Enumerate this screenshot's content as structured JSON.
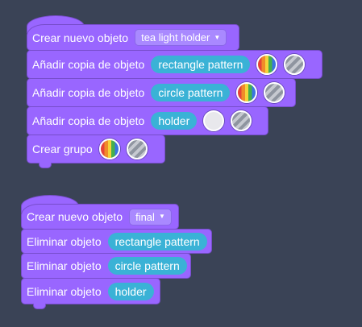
{
  "stack1": {
    "create_label": "Crear nuevo objeto",
    "object_name": "tea light holder",
    "copy_label": "Añadir copia de objeto",
    "copy_targets": [
      "rectangle pattern",
      "circle pattern",
      "holder"
    ],
    "group_label": "Crear grupo"
  },
  "stack2": {
    "create_label": "Crear nuevo objeto",
    "object_name": "final",
    "delete_label": "Eliminar objeto",
    "delete_targets": [
      "rectangle pattern",
      "circle pattern",
      "holder"
    ]
  },
  "colors": {
    "background": "#3a4356",
    "block": "#9966ff",
    "reporter": "#3ab2d6"
  },
  "icons": {
    "dropdown": "chevron-down-icon",
    "color_swatch": "rainbow-color-icon",
    "pattern_swatch": "striped-pattern-icon",
    "plain_swatch": "plain-color-icon"
  }
}
